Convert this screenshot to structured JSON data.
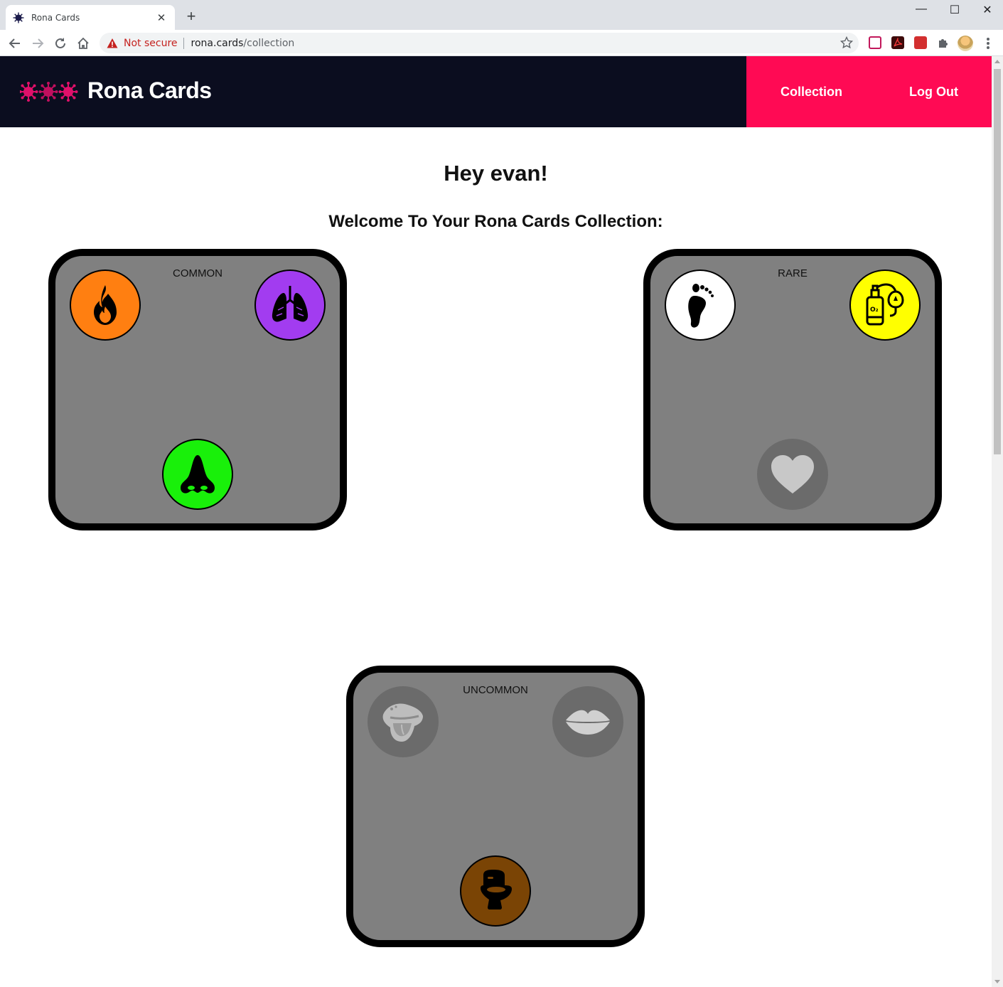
{
  "browser": {
    "tab_title": "Rona Cards",
    "security_label": "Not secure",
    "url_host": "rona.cards",
    "url_path": "/collection"
  },
  "header": {
    "brand": "Rona Cards",
    "nav": [
      {
        "label": "Collection"
      },
      {
        "label": "Log Out"
      }
    ],
    "colors": {
      "background": "#0b0d1f",
      "nav_background": "#ff0a54",
      "logo_virus": "#e0106a"
    }
  },
  "main": {
    "greeting": "Hey evan!",
    "subtitle": "Welcome To Your Rona Cards Collection:"
  },
  "cards": [
    {
      "label": "COMMON",
      "slots": [
        {
          "icon": "fire-icon",
          "color": "#ff7f11",
          "owned": true
        },
        {
          "icon": "lungs-icon",
          "color": "#a23cf0",
          "owned": true
        },
        {
          "icon": "nose-icon",
          "color": "#19f00a",
          "owned": true
        }
      ]
    },
    {
      "label": "RARE",
      "slots": [
        {
          "icon": "foot-icon",
          "color": "#ffffff",
          "owned": true
        },
        {
          "icon": "oxygen-tank-icon",
          "color": "#ffff00",
          "owned": true
        },
        {
          "icon": "heart-icon",
          "color": "#6b6b6b",
          "owned": false
        }
      ]
    },
    {
      "label": "UNCOMMON",
      "slots": [
        {
          "icon": "tongue-icon",
          "color": "#6b6b6b",
          "owned": false
        },
        {
          "icon": "lips-icon",
          "color": "#6b6b6b",
          "owned": false
        },
        {
          "icon": "toilet-icon",
          "color": "#7a4405",
          "owned": true
        }
      ]
    }
  ]
}
